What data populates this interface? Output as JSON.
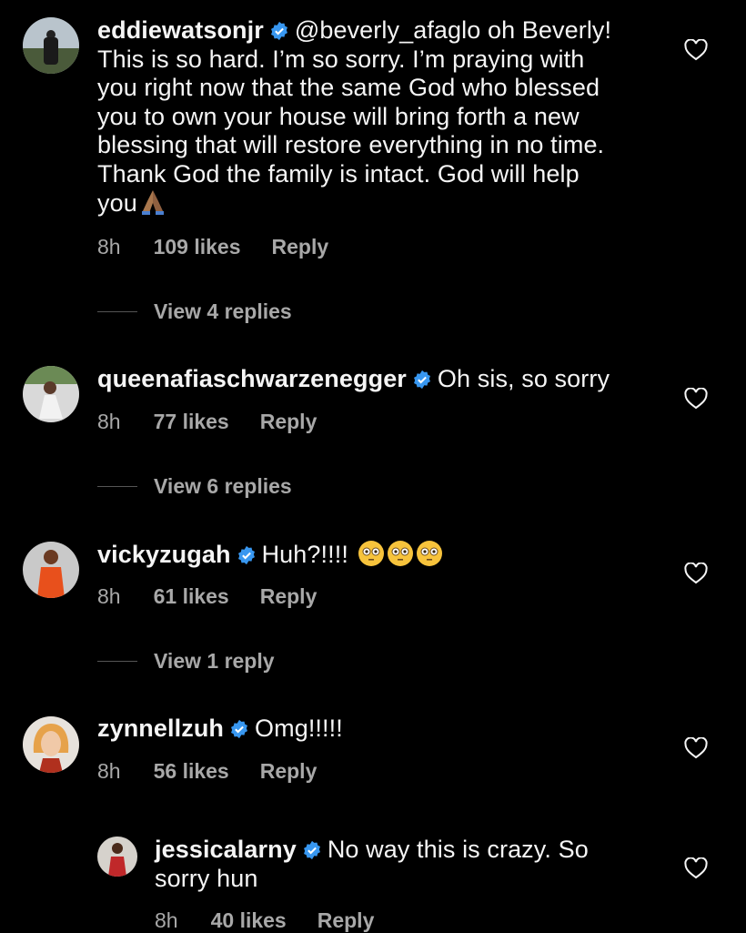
{
  "comments": [
    {
      "username": "eddiewatsonjr",
      "text_lines": [
        "@beverly_afaglo oh Beverly!",
        "This is so hard. I’m so sorry. I’m praying with",
        "you right now that the same God who blessed",
        "you to own your house will bring forth a new",
        "blessing that will restore everything in no time.",
        "Thank God the family is intact. God will help",
        "you"
      ],
      "time": "8h",
      "likes": "109 likes",
      "reply": "Reply",
      "view_replies": "View 4 replies",
      "emoji": "folded-hands"
    },
    {
      "username": "queenafiaschwarzenegger",
      "text": "Oh sis, so sorry",
      "time": "8h",
      "likes": "77 likes",
      "reply": "Reply",
      "view_replies": "View 6 replies"
    },
    {
      "username": "vickyzugah",
      "text": "Huh?!!!!",
      "time": "8h",
      "likes": "61 likes",
      "reply": "Reply",
      "view_replies": "View 1 reply",
      "emoji": "flushed-face x3"
    },
    {
      "username": "zynnellzuh",
      "text": "Omg!!!!!",
      "time": "8h",
      "likes": "56 likes",
      "reply": "Reply"
    },
    {
      "username": "jessicalarny",
      "text_lines": [
        "No way this is crazy. So",
        "sorry hun"
      ],
      "time": "8h",
      "likes": "40 likes",
      "reply": "Reply"
    }
  ],
  "colors": {
    "background": "#000000",
    "text": "#f5f5f5",
    "secondary": "#a8a8a8",
    "verified": "#3897f0"
  },
  "icons": [
    "verified-badge-icon",
    "heart-icon",
    "folded-hands-emoji",
    "flushed-face-emoji"
  ]
}
